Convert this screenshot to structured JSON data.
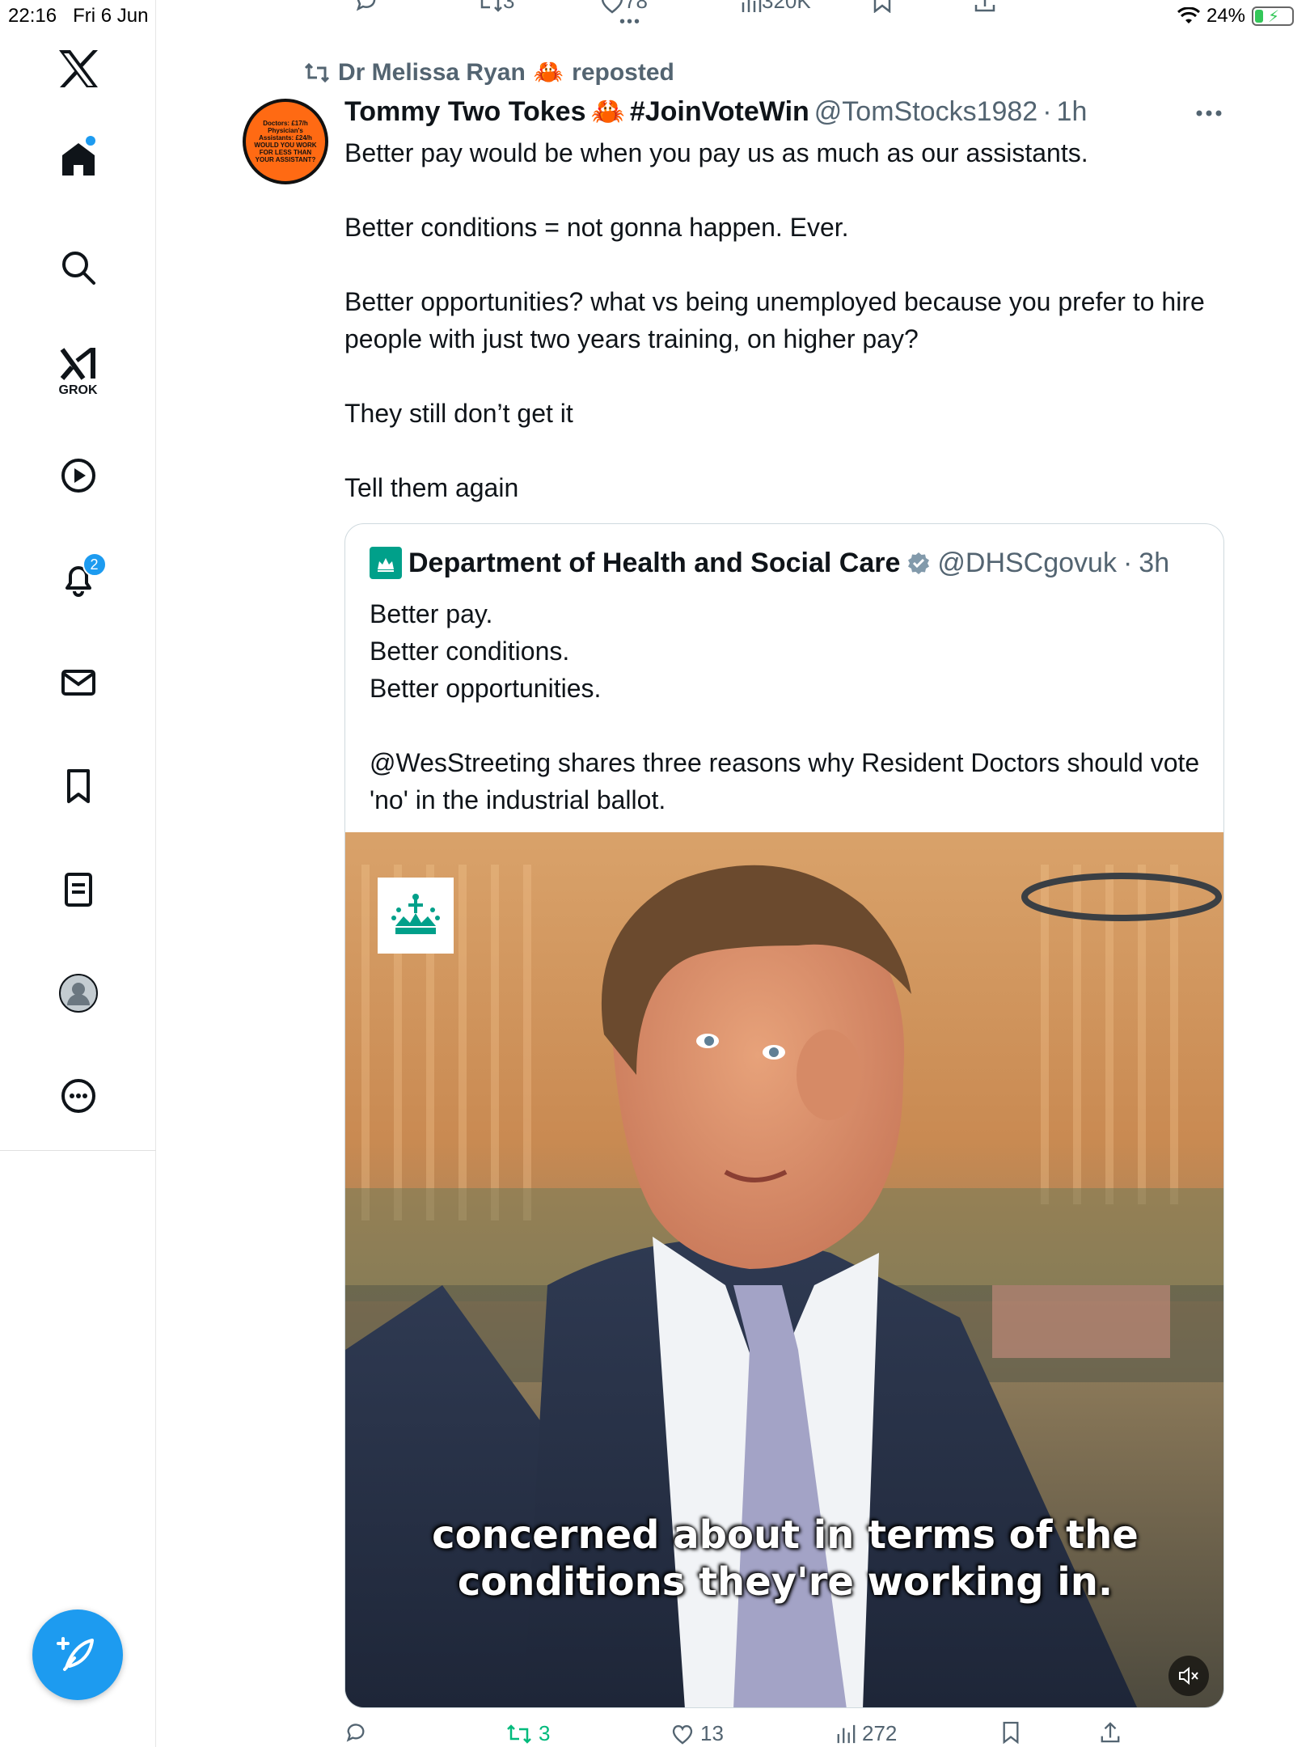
{
  "status_bar": {
    "time": "22:16",
    "date": "Fri 6 Jun",
    "battery": "24%"
  },
  "sidebar": {
    "items": [
      {
        "icon": "x-logo-icon"
      },
      {
        "icon": "home-icon",
        "has_dot": true
      },
      {
        "icon": "search-icon"
      },
      {
        "icon": "grok-icon",
        "label": "GROK"
      },
      {
        "icon": "video-play-icon"
      },
      {
        "icon": "bell-icon",
        "badge": "2"
      },
      {
        "icon": "mail-icon"
      },
      {
        "icon": "bookmark-icon"
      },
      {
        "icon": "lists-icon"
      },
      {
        "icon": "profile-icon"
      },
      {
        "icon": "more-circle-icon"
      }
    ],
    "compose_icon": "compose-feather-icon"
  },
  "previous_tweet_actions": {
    "retweets": "3",
    "likes": "78",
    "views": "320K"
  },
  "tweet": {
    "reposted_by": "Dr Melissa Ryan",
    "reposted_suffix": "reposted",
    "author_name": "Tommy Two Tokes",
    "author_hashtag": "#JoinVoteWin",
    "handle": "@TomStocks1982",
    "separator": "·",
    "time": "1h",
    "avatar_text": "Doctors: £17/h Physician's Assistants: £24/h WOULD YOU WORK FOR LESS THAN YOUR ASSISTANT?",
    "paragraphs": [
      "Better pay would be when you pay us as much as our assistants.",
      "Better conditions = not gonna happen. Ever.",
      "Better opportunities? what vs being unemployed because you prefer to hire people with just two years training, on higher pay?",
      "They still don’t get it",
      "Tell them again"
    ],
    "quote": {
      "name": "Department of Health and Social Care",
      "handle": "@DHSCgovuk",
      "separator": "·",
      "time": "3h",
      "lines": [
        "Better pay.",
        "Better conditions.",
        "Better opportunities."
      ],
      "text": "@WesStreeting shares three reasons why Resident Doctors should vote 'no' in the industrial ballot.",
      "video_caption_1": "concerned about in terms of the",
      "video_caption_2": "conditions they're working in."
    },
    "actions": {
      "replies": "",
      "retweets": "3",
      "likes": "13",
      "views": "272"
    }
  },
  "colors": {
    "accent": "#1d9bf0",
    "repost_green": "#00ba7c",
    "secondary_text": "#536471",
    "avatar_orange": "#ff6a13",
    "dhsc_teal": "#00a08a"
  }
}
